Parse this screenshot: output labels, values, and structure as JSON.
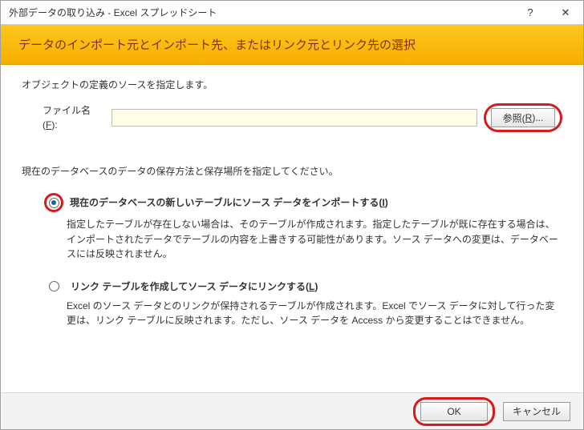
{
  "titlebar": {
    "title": "外部データの取り込み - Excel スプレッドシート",
    "help": "?",
    "close": "✕"
  },
  "header": {
    "title": "データのインポート元とインポート先、またはリンク元とリンク先の選択"
  },
  "content": {
    "object_source_label": "オブジェクトの定義のソースを指定します。",
    "file": {
      "label": "ファイル名(F):",
      "value": "",
      "browse": "参照(R)..."
    },
    "storage_intro": "現在のデータベースのデータの保存方法と保存場所を指定してください。",
    "option1": {
      "label": "現在のデータベースの新しいテーブルにソース データをインポートする(I)",
      "desc": "指定したテーブルが存在しない場合は、そのテーブルが作成されます。指定したテーブルが既に存在する場合は、インポートされたデータでテーブルの内容を上書きする可能性があります。ソース データへの変更は、データベースには反映されません。"
    },
    "option2": {
      "label": "リンク テーブルを作成してソース データにリンクする(L)",
      "desc": "Excel のソース データとのリンクが保持されるテーブルが作成されます。Excel でソース データに対して行った変更は、リンク テーブルに反映されます。ただし、ソース データを Access から変更することはできません。"
    }
  },
  "footer": {
    "ok": "OK",
    "cancel": "キャンセル"
  }
}
